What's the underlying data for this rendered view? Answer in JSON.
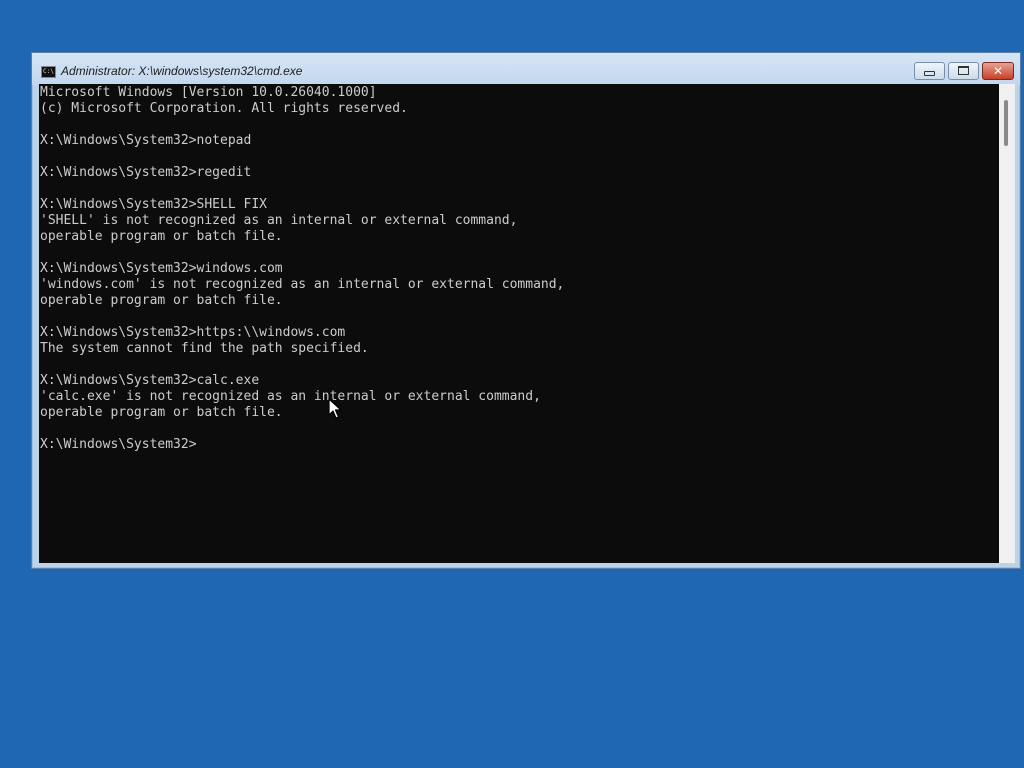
{
  "window": {
    "title": "Administrator: X:\\windows\\system32\\cmd.exe",
    "icon_label": "C:\\",
    "controls": {
      "close_label": "✕"
    }
  },
  "console": {
    "lines": [
      "Microsoft Windows [Version 10.0.26040.1000]",
      "(c) Microsoft Corporation. All rights reserved.",
      "",
      "X:\\Windows\\System32>notepad",
      "",
      "X:\\Windows\\System32>regedit",
      "",
      "X:\\Windows\\System32>SHELL FIX",
      "'SHELL' is not recognized as an internal or external command,",
      "operable program or batch file.",
      "",
      "X:\\Windows\\System32>windows.com",
      "'windows.com' is not recognized as an internal or external command,",
      "operable program or batch file.",
      "",
      "X:\\Windows\\System32>https:\\\\windows.com",
      "The system cannot find the path specified.",
      "",
      "X:\\Windows\\System32>calc.exe",
      "'calc.exe' is not recognized as an internal or external command,",
      "operable program or batch file.",
      "",
      "X:\\Windows\\System32>"
    ]
  },
  "colors": {
    "desktop": "#1f67b1",
    "console_bg": "#0c0c0c",
    "console_fg": "#cccccc",
    "close_button": "#c7402a"
  },
  "icons": {
    "window": "cmd-icon",
    "minimize": "minimize-icon",
    "maximize": "maximize-icon",
    "close": "close-icon",
    "pointer": "mouse-pointer-icon"
  }
}
